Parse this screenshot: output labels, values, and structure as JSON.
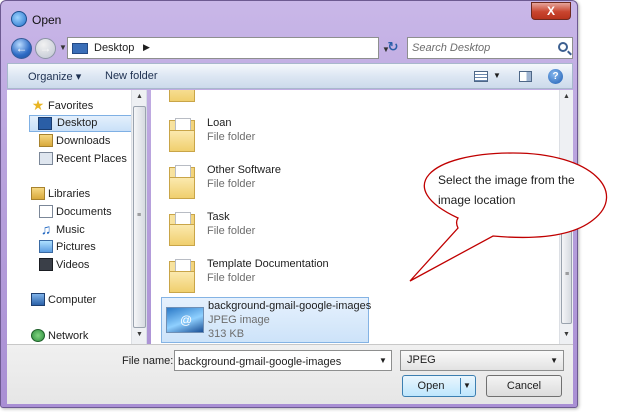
{
  "window": {
    "title": "Open",
    "close_label": "X"
  },
  "address_bar": {
    "location": "Desktop",
    "search_placeholder": "Search Desktop"
  },
  "toolbar": {
    "organize": "Organize ▾",
    "new_folder": "New folder",
    "help": "?"
  },
  "nav": {
    "favorites": "Favorites",
    "desktop": "Desktop",
    "downloads": "Downloads",
    "recent_places": "Recent Places",
    "libraries": "Libraries",
    "documents": "Documents",
    "music": "Music",
    "pictures": "Pictures",
    "videos": "Videos",
    "computer": "Computer",
    "network": "Network"
  },
  "files": [
    {
      "name": "",
      "type": "File folder"
    },
    {
      "name": "Loan",
      "type": "File folder"
    },
    {
      "name": "Other Software",
      "type": "File folder"
    },
    {
      "name": "Task",
      "type": "File folder"
    },
    {
      "name": "Template Documentation",
      "type": "File folder"
    },
    {
      "name": "background-gmail-google-images",
      "type": "JPEG image",
      "size": "313 KB"
    }
  ],
  "bottom": {
    "filename_label": "File name:",
    "filename_value": "background-gmail-google-images",
    "filetype_value": "JPEG",
    "open_label": "Open",
    "cancel_label": "Cancel"
  },
  "callout": {
    "text": "Select the image from the image location"
  }
}
